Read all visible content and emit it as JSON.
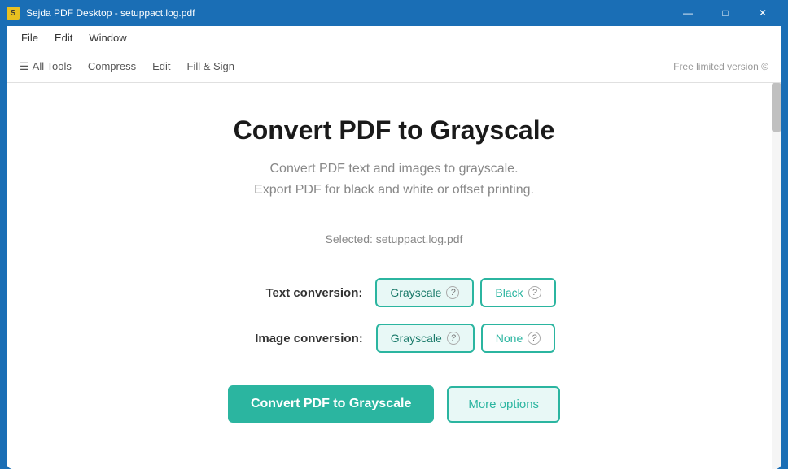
{
  "window": {
    "title": "Sejda PDF Desktop - setuppact.log.pdf",
    "icon": "S",
    "controls": {
      "minimize": "—",
      "maximize": "□",
      "close": "✕"
    }
  },
  "menu": {
    "items": [
      "File",
      "Edit",
      "Window"
    ]
  },
  "toolbar": {
    "items": [
      "All Tools",
      "Compress",
      "Edit",
      "Fill & Sign"
    ],
    "promo": "Free limited version ©"
  },
  "page": {
    "title": "Convert PDF to Grayscale",
    "subtitle_line1": "Convert PDF text and images to grayscale.",
    "subtitle_line2": "Export PDF for black and white or offset printing.",
    "selected_file": "Selected: setuppact.log.pdf"
  },
  "form": {
    "text_conversion": {
      "label": "Text conversion:",
      "options": [
        {
          "label": "Grayscale",
          "selected": true
        },
        {
          "label": "Black",
          "selected": false
        }
      ]
    },
    "image_conversion": {
      "label": "Image conversion:",
      "options": [
        {
          "label": "Grayscale",
          "selected": true
        },
        {
          "label": "None",
          "selected": false
        }
      ]
    }
  },
  "actions": {
    "primary": "Convert PDF to Grayscale",
    "secondary": "More options"
  }
}
